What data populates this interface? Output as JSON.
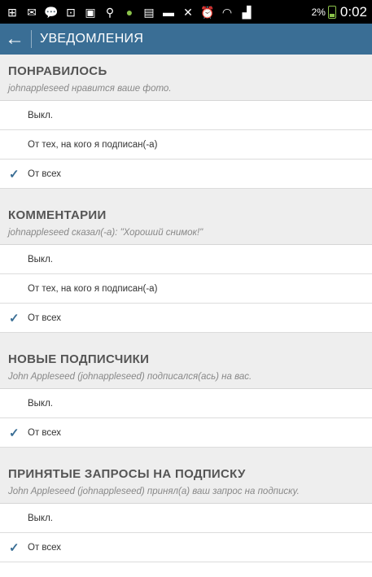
{
  "status_bar": {
    "icons": [
      "plus-box-icon",
      "mail-icon",
      "chat-icon",
      "screenshot-icon",
      "image-icon",
      "search-icon",
      "bug-icon",
      "clipboard-icon",
      "messages-icon",
      "mute-icon",
      "alarm-icon",
      "wifi-icon",
      "signal-icon"
    ],
    "battery": "2%",
    "time": "0:02"
  },
  "action_bar": {
    "title": "УВЕДОМЛЕНИЯ",
    "color": "#3a6e95"
  },
  "sections": [
    {
      "title": "ПОНРАВИЛОСЬ",
      "subtitle": "johnappleseed нравится ваше фото.",
      "options": [
        {
          "label": "Выкл.",
          "checked": false
        },
        {
          "label": "От тех, на кого я подписан(-а)",
          "checked": false
        },
        {
          "label": "От всех",
          "checked": true
        }
      ]
    },
    {
      "title": "КОММЕНТАРИИ",
      "subtitle": "johnappleseed сказал(-а): \"Хороший снимок!\"",
      "options": [
        {
          "label": "Выкл.",
          "checked": false
        },
        {
          "label": "От тех, на кого я подписан(-а)",
          "checked": false
        },
        {
          "label": "От всех",
          "checked": true
        }
      ]
    },
    {
      "title": "НОВЫЕ ПОДПИСЧИКИ",
      "subtitle": "John Appleseed (johnappleseed) подписался(ась) на вас.",
      "options": [
        {
          "label": "Выкл.",
          "checked": false
        },
        {
          "label": "От всех",
          "checked": true
        }
      ]
    },
    {
      "title": "ПРИНЯТЫЕ ЗАПРОСЫ НА ПОДПИСКУ",
      "subtitle": "John Appleseed (johnappleseed) принял(а) ваш запрос на подписку.",
      "options": [
        {
          "label": "Выкл.",
          "checked": false
        },
        {
          "label": "От всех",
          "checked": true
        }
      ]
    }
  ],
  "check_glyph": "✓"
}
